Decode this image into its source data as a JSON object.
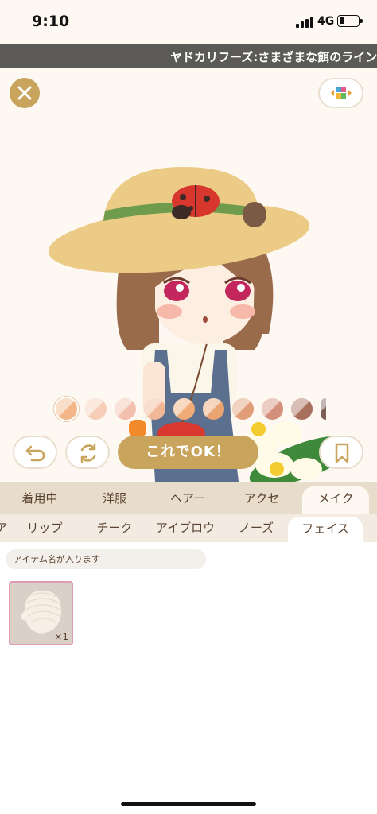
{
  "status_bar": {
    "time": "9:10",
    "network": "4G"
  },
  "ticker": {
    "text": "ヤドカリフーズ:さまざまな餌のライン"
  },
  "toolbar": {
    "close_icon": "close-icon",
    "wardrobe_icon": "wardrobe-grid-icon"
  },
  "color_palette": {
    "selected_index": 0,
    "colors": [
      "#f2b688",
      "#f6cdb6",
      "#f3c0ad",
      "#f2b796",
      "#f0ab76",
      "#e9a471",
      "#e19d77",
      "#d48f7a",
      "#a8705c",
      "#7b5f57"
    ]
  },
  "actions": {
    "ok_label": "これでOK！",
    "undo_icon": "undo-icon",
    "refresh_icon": "refresh-icon",
    "bookmark_icon": "bookmark-icon"
  },
  "category_tabs": [
    {
      "label": "着用中"
    },
    {
      "label": "洋服"
    },
    {
      "label": "ヘアー"
    },
    {
      "label": "アクセ"
    },
    {
      "label": "メイク",
      "active": true
    }
  ],
  "sub_tabs": [
    {
      "label": "ア"
    },
    {
      "label": "リップ"
    },
    {
      "label": "チーク"
    },
    {
      "label": "アイブロウ"
    },
    {
      "label": "ノーズ"
    },
    {
      "label": "フェイス",
      "active": true
    }
  ],
  "search": {
    "placeholder": "アイテム名が入ります"
  },
  "items": [
    {
      "count": "×1"
    }
  ]
}
